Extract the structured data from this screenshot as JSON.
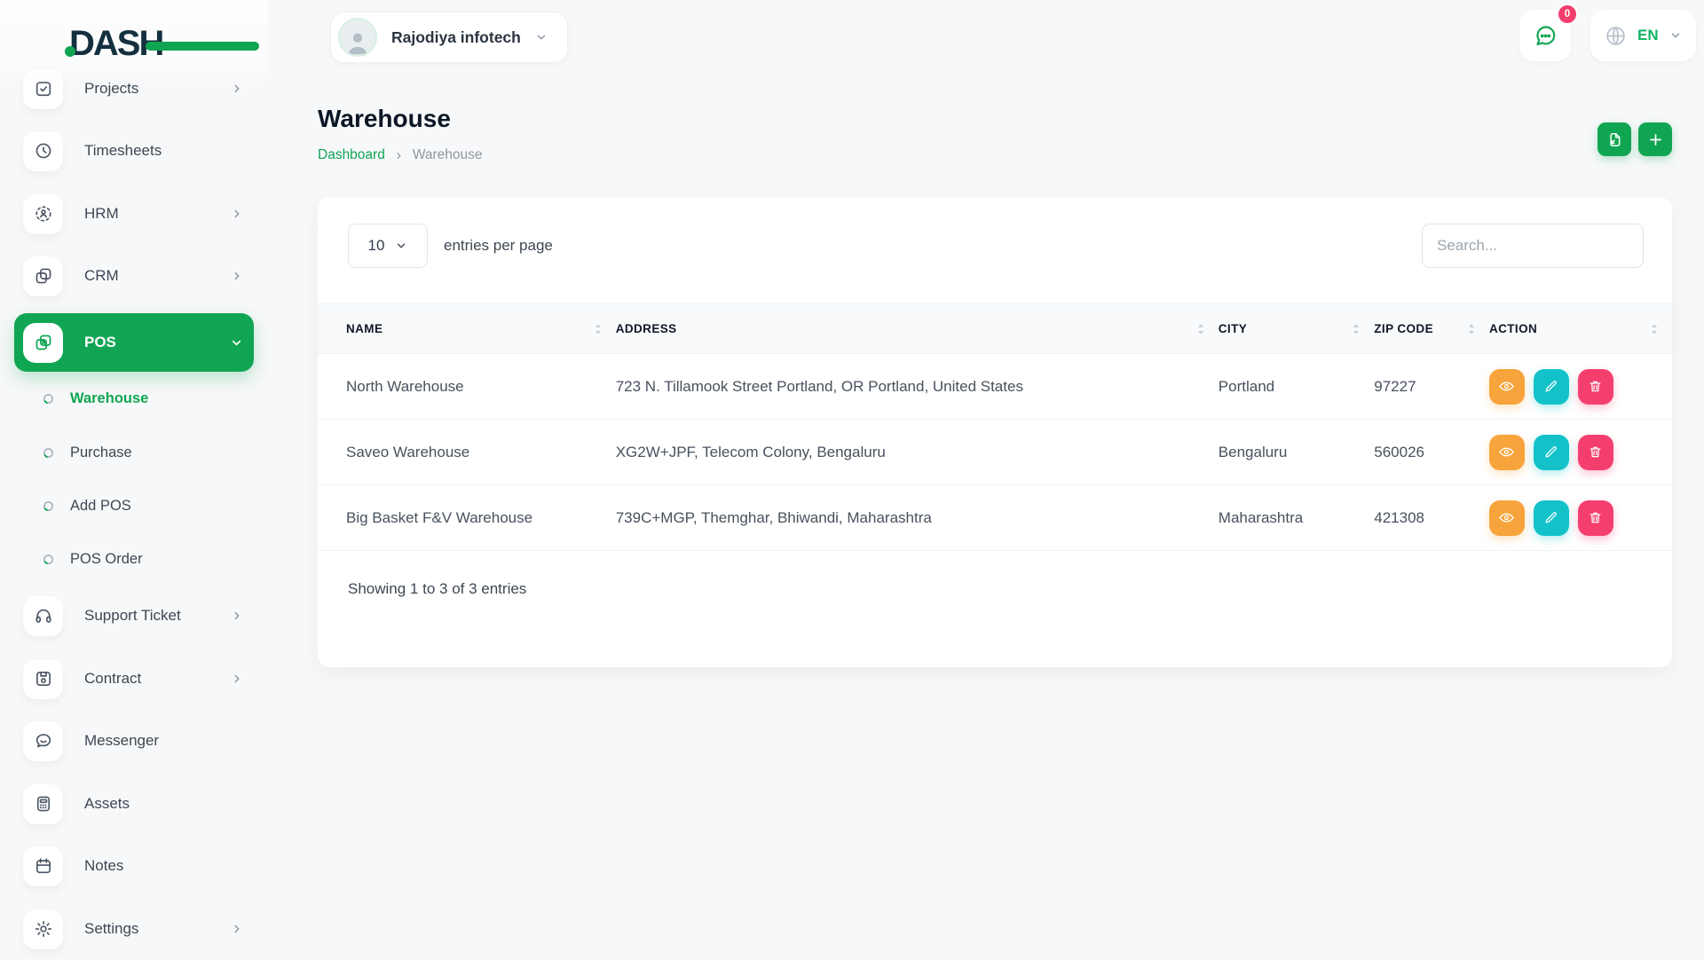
{
  "brand": {
    "logo_text": "DASH"
  },
  "topbar": {
    "company_name": "Rajodiya infotech",
    "chat_badge_count": "0",
    "language_code": "EN"
  },
  "sidebar": {
    "items": [
      {
        "label": "Projects"
      },
      {
        "label": "Timesheets"
      },
      {
        "label": "HRM"
      },
      {
        "label": "CRM"
      },
      {
        "label": "POS"
      },
      {
        "label": "Support Ticket"
      },
      {
        "label": "Contract"
      },
      {
        "label": "Messenger"
      },
      {
        "label": "Assets"
      },
      {
        "label": "Notes"
      },
      {
        "label": "Settings"
      }
    ],
    "pos_children": [
      {
        "label": "Warehouse"
      },
      {
        "label": "Purchase"
      },
      {
        "label": "Add POS"
      },
      {
        "label": "POS Order"
      }
    ]
  },
  "page": {
    "title": "Warehouse",
    "breadcrumb_home": "Dashboard",
    "breadcrumb_current": "Warehouse"
  },
  "table_card": {
    "entries_per_page_value": "10",
    "entries_per_page_label": "entries per page",
    "search_placeholder": "Search...",
    "columns": [
      "NAME",
      "ADDRESS",
      "CITY",
      "ZIP CODE",
      "ACTION"
    ],
    "rows": [
      {
        "name": "North Warehouse",
        "address": "723 N. Tillamook Street Portland, OR Portland, United States",
        "city": "Portland",
        "zip_code": "97227"
      },
      {
        "name": "Saveo Warehouse",
        "address": "XG2W+JPF, Telecom Colony, Bengaluru",
        "city": "Bengaluru",
        "zip_code": "560026"
      },
      {
        "name": "Big Basket F&V Warehouse",
        "address": "739C+MGP, Themghar, Bhiwandi, Maharashtra",
        "city": "Maharashtra",
        "zip_code": "421308"
      }
    ],
    "footer_text": "Showing 1 to 3 of 3 entries"
  },
  "colors": {
    "primary_green": "#10a552",
    "warning_orange": "#f6a43b",
    "info_cyan": "#13c2c9",
    "danger_pink": "#f43f6e",
    "badge_pink": "#f43f6e"
  }
}
